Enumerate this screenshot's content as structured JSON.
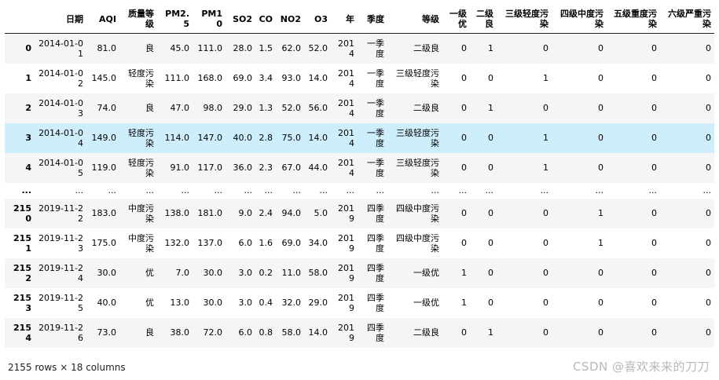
{
  "columns": [
    "",
    "日期",
    "AQI",
    "质量等级",
    "PM2.5",
    "PM10",
    "SO2",
    "CO",
    "NO2",
    "O3",
    "年",
    "季度",
    "等级",
    "一级优",
    "二级良",
    "三级轻度污染",
    "四级中度污染",
    "五级重度污染",
    "六级严重污染"
  ],
  "rows": [
    {
      "idx": "0",
      "cells": [
        "2014-01-01",
        "81.0",
        "良",
        "45.0",
        "111.0",
        "28.0",
        "1.5",
        "62.0",
        "52.0",
        "2014",
        "一季度",
        "二级良",
        "0",
        "1",
        "0",
        "0",
        "0",
        "0"
      ]
    },
    {
      "idx": "1",
      "cells": [
        "2014-01-02",
        "145.0",
        "轻度污染",
        "111.0",
        "168.0",
        "69.0",
        "3.4",
        "93.0",
        "14.0",
        "2014",
        "一季度",
        "三级轻度污染",
        "0",
        "0",
        "1",
        "0",
        "0",
        "0"
      ]
    },
    {
      "idx": "2",
      "cells": [
        "2014-01-03",
        "74.0",
        "良",
        "47.0",
        "98.0",
        "29.0",
        "1.3",
        "52.0",
        "56.0",
        "2014",
        "一季度",
        "二级良",
        "0",
        "1",
        "0",
        "0",
        "0",
        "0"
      ]
    },
    {
      "idx": "3",
      "cells": [
        "2014-01-04",
        "149.0",
        "轻度污染",
        "114.0",
        "147.0",
        "40.0",
        "2.8",
        "75.0",
        "14.0",
        "2014",
        "一季度",
        "三级轻度污染",
        "0",
        "0",
        "1",
        "0",
        "0",
        "0"
      ]
    },
    {
      "idx": "4",
      "cells": [
        "2014-01-05",
        "119.0",
        "轻度污染",
        "91.0",
        "117.0",
        "36.0",
        "2.3",
        "67.0",
        "44.0",
        "2014",
        "一季度",
        "三级轻度污染",
        "0",
        "0",
        "1",
        "0",
        "0",
        "0"
      ]
    },
    {
      "idx": "...",
      "cells": [
        "...",
        "...",
        "...",
        "...",
        "...",
        "...",
        "...",
        "...",
        "...",
        "...",
        "...",
        "...",
        "...",
        "...",
        "...",
        "...",
        "...",
        "..."
      ]
    },
    {
      "idx": "2150",
      "cells": [
        "2019-11-22",
        "183.0",
        "中度污染",
        "138.0",
        "181.0",
        "9.0",
        "2.4",
        "94.0",
        "5.0",
        "2019",
        "四季度",
        "四级中度污染",
        "0",
        "0",
        "0",
        "1",
        "0",
        "0"
      ]
    },
    {
      "idx": "2151",
      "cells": [
        "2019-11-23",
        "175.0",
        "中度污染",
        "132.0",
        "137.0",
        "6.0",
        "1.6",
        "69.0",
        "34.0",
        "2019",
        "四季度",
        "四级中度污染",
        "0",
        "0",
        "0",
        "1",
        "0",
        "0"
      ]
    },
    {
      "idx": "2152",
      "cells": [
        "2019-11-24",
        "30.0",
        "优",
        "7.0",
        "30.0",
        "3.0",
        "0.2",
        "11.0",
        "58.0",
        "2019",
        "四季度",
        "一级优",
        "1",
        "0",
        "0",
        "0",
        "0",
        "0"
      ]
    },
    {
      "idx": "2153",
      "cells": [
        "2019-11-25",
        "40.0",
        "优",
        "13.0",
        "30.0",
        "3.0",
        "0.4",
        "32.0",
        "29.0",
        "2019",
        "四季度",
        "一级优",
        "1",
        "0",
        "0",
        "0",
        "0",
        "0"
      ]
    },
    {
      "idx": "2154",
      "cells": [
        "2019-11-26",
        "73.0",
        "良",
        "38.0",
        "72.0",
        "6.0",
        "0.8",
        "58.0",
        "14.0",
        "2019",
        "四季度",
        "二级良",
        "0",
        "1",
        "0",
        "0",
        "0",
        "0"
      ]
    }
  ],
  "footer": "2155 rows × 18 columns",
  "watermark": "CSDN @喜欢来来的刀刀",
  "colors": {
    "row_odd": "#f5f5f5",
    "row_even": "#ffffff",
    "row_hover": "#cfeefc"
  }
}
